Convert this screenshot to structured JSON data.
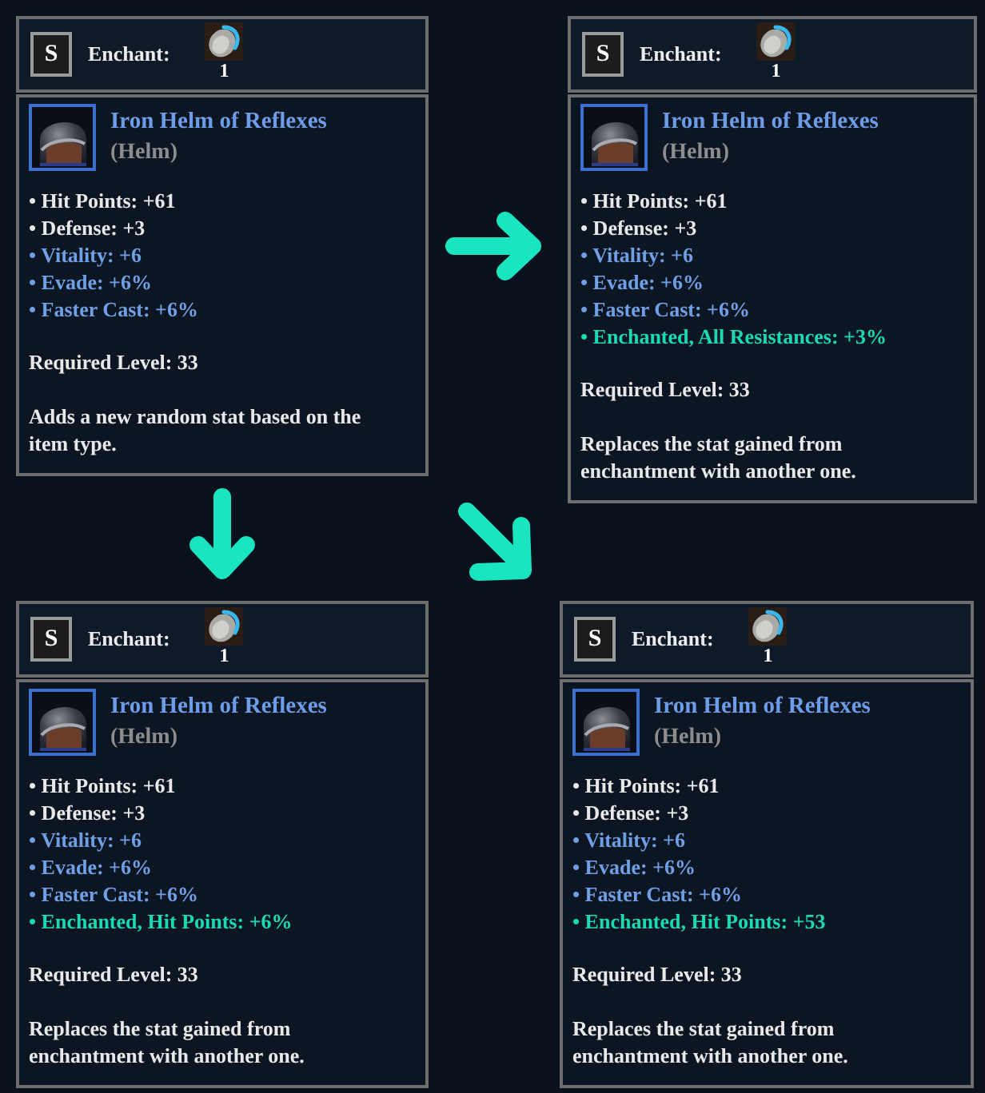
{
  "panels": [
    {
      "hotkey": "S",
      "action_label": "Enchant:",
      "cost": "1",
      "item": {
        "name": "Iron Helm of Reflexes",
        "type": "(Helm)"
      },
      "stats": [
        {
          "text": "• Hit Points: +61",
          "kind": "base"
        },
        {
          "text": "• Defense: +3",
          "kind": "base"
        },
        {
          "text": "• Vitality: +6",
          "kind": "magic"
        },
        {
          "text": "• Evade: +6%",
          "kind": "magic"
        },
        {
          "text": "• Faster Cast: +6%",
          "kind": "magic"
        }
      ],
      "requirement": "Required Level: 33",
      "description": "Adds a new random stat based on the item type."
    },
    {
      "hotkey": "S",
      "action_label": "Enchant:",
      "cost": "1",
      "item": {
        "name": "Iron Helm of Reflexes",
        "type": "(Helm)"
      },
      "stats": [
        {
          "text": "• Hit Points: +61",
          "kind": "base"
        },
        {
          "text": "• Defense: +3",
          "kind": "base"
        },
        {
          "text": "• Vitality: +6",
          "kind": "magic"
        },
        {
          "text": "• Evade: +6%",
          "kind": "magic"
        },
        {
          "text": "• Faster Cast: +6%",
          "kind": "magic"
        },
        {
          "text": "• Enchanted, All Resistances: +3%",
          "kind": "enchanted"
        }
      ],
      "requirement": "Required Level: 33",
      "description": "Replaces the stat gained from enchantment with another one."
    },
    {
      "hotkey": "S",
      "action_label": "Enchant:",
      "cost": "1",
      "item": {
        "name": "Iron Helm of Reflexes",
        "type": "(Helm)"
      },
      "stats": [
        {
          "text": "• Hit Points: +61",
          "kind": "base"
        },
        {
          "text": "• Defense: +3",
          "kind": "base"
        },
        {
          "text": "• Vitality: +6",
          "kind": "magic"
        },
        {
          "text": "• Evade: +6%",
          "kind": "magic"
        },
        {
          "text": "• Faster Cast: +6%",
          "kind": "magic"
        },
        {
          "text": "• Enchanted, Hit Points: +6%",
          "kind": "enchanted"
        }
      ],
      "requirement": "Required Level: 33",
      "description": "Replaces the stat gained from enchantment with another one."
    },
    {
      "hotkey": "S",
      "action_label": "Enchant:",
      "cost": "1",
      "item": {
        "name": "Iron Helm of Reflexes",
        "type": "(Helm)"
      },
      "stats": [
        {
          "text": "• Hit Points: +61",
          "kind": "base"
        },
        {
          "text": "• Defense: +3",
          "kind": "base"
        },
        {
          "text": "• Vitality: +6",
          "kind": "magic"
        },
        {
          "text": "• Evade: +6%",
          "kind": "magic"
        },
        {
          "text": "• Faster Cast: +6%",
          "kind": "magic"
        },
        {
          "text": "• Enchanted, Hit Points: +53",
          "kind": "enchanted"
        }
      ],
      "requirement": "Required Level: 33",
      "description": "Replaces the stat gained from enchantment with another one."
    }
  ]
}
